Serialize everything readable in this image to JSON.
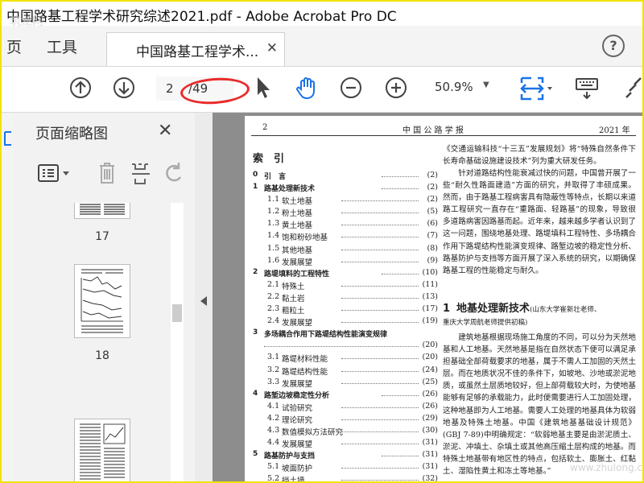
{
  "window": {
    "title": "中国路基工程学术研究综述2021.pdf - Adobe Acrobat Pro DC"
  },
  "tabs": {
    "home_partial": "页",
    "tools": "工具",
    "document": "中国路基工程学术..."
  },
  "toolbar": {
    "current_page": "2",
    "page_separator": "/",
    "total_pages": "49",
    "zoom": "50.9%"
  },
  "panel": {
    "title": "页面缩略图",
    "thumbnails": [
      {
        "number": "17"
      },
      {
        "number": "18"
      }
    ]
  },
  "page": {
    "header_left": "2",
    "journal": "中 国 公 路 学 报",
    "header_right": "2021 年",
    "toc_title": "索　引",
    "toc": [
      {
        "num": "0",
        "label": "引　言",
        "page": "(2)",
        "level": "main"
      },
      {
        "num": "1",
        "label": "路基处理新技术",
        "page": "(2)",
        "level": "main"
      },
      {
        "num": "1.1",
        "label": "软土地基",
        "page": "(2)",
        "level": "sub"
      },
      {
        "num": "1.2",
        "label": "粉土地基",
        "page": "(5)",
        "level": "sub"
      },
      {
        "num": "1.3",
        "label": "黄土地基",
        "page": "(6)",
        "level": "sub"
      },
      {
        "num": "1.4",
        "label": "饱和粉砂地基",
        "page": "(7)",
        "level": "sub"
      },
      {
        "num": "1.5",
        "label": "其他地基",
        "page": "(8)",
        "level": "sub"
      },
      {
        "num": "1.6",
        "label": "发展展望",
        "page": "(9)",
        "level": "sub"
      },
      {
        "num": "2",
        "label": "路堤填料的工程特性",
        "page": "(10)",
        "level": "main"
      },
      {
        "num": "2.1",
        "label": "特殊土",
        "page": "(11)",
        "level": "sub"
      },
      {
        "num": "2.2",
        "label": "黏土岩",
        "page": "(13)",
        "level": "sub"
      },
      {
        "num": "2.3",
        "label": "粗粒土",
        "page": "(17)",
        "level": "sub"
      },
      {
        "num": "2.4",
        "label": "发展展望",
        "page": "(19)",
        "level": "sub"
      },
      {
        "num": "3",
        "label": "多场耦合作用下路堤结构性能演变规律",
        "page": "",
        "level": "main"
      },
      {
        "num": "",
        "label": "",
        "page": "(20)",
        "level": "cont"
      },
      {
        "num": "3.1",
        "label": "路堤材料性能",
        "page": "(20)",
        "level": "sub"
      },
      {
        "num": "3.2",
        "label": "路堤结构性能",
        "page": "(24)",
        "level": "sub"
      },
      {
        "num": "3.3",
        "label": "发展展望",
        "page": "(25)",
        "level": "sub"
      },
      {
        "num": "4",
        "label": "路堑边坡稳定性分析",
        "page": "(26)",
        "level": "main"
      },
      {
        "num": "4.1",
        "label": "试验研究",
        "page": "(26)",
        "level": "sub"
      },
      {
        "num": "4.2",
        "label": "理论研究",
        "page": "(29)",
        "level": "sub"
      },
      {
        "num": "4.3",
        "label": "数值模拟方法研究",
        "page": "(30)",
        "level": "sub"
      },
      {
        "num": "4.4",
        "label": "发展展望",
        "page": "(31)",
        "level": "sub"
      },
      {
        "num": "5",
        "label": "路基防护与支挡",
        "page": "(31)",
        "level": "main"
      },
      {
        "num": "5.1",
        "label": "坡面防护",
        "page": "(31)",
        "level": "sub"
      },
      {
        "num": "5.2",
        "label": "挡土墙",
        "page": "(32)",
        "level": "sub"
      }
    ],
    "para1": "《交通运输科技“十三五”发展规划》将“特殊自然条件下长寿命基础设施建设技术”列为重大研发任务。",
    "para2": "针对道路结构性能衰减过快的问题，中国曾开展了一些“耐久性路面建造”方面的研究，并取得了丰硕成果。然而，由于路基工程病害具有隐蔽性等特点，长期以来道路工程研究一直存在“重路面、轻路基”的现象，导致很多道路病害因路基而起。近年来，越来越多学者认识到了这一问题，围绕地基处理、路堤填料工程特性、多场耦合作用下路堤结构性能演变规律、路堑边坡的稳定性分析、路基防护与支挡等方面开展了深入系统的研究，以期确保路基工程的性能稳定与耐久。",
    "section1": {
      "number": "1",
      "title": "地基处理新技术",
      "authors": "(山东大学崔新壮老师、",
      "authors2": "重庆大学周航老师提供初稿)"
    },
    "para3": "建筑地基根据现场施工角度的不同，可以分为天然地基和人工地基。天然地基是指在自然状态下便可以满足承担基础全部荷载要求的地基，属于不需人工加固的天然土层。而在地质状况不佳的条件下，如坡地、沙地或淤泥地质，或虽然土层质地较好，但上部荷载较大时，为使地基能够有足够的承载能力，此时便需要进行人工加固处理，这种地基即为人工地基。需要人工处理的地基具体为软弱地基及特殊土地基。中国《建筑地基基础设计规范》(GBJ 7-89)中明确规定：“软弱地基主要是由淤泥质土、淤泥、冲填土、杂填土或其他高压缩土层构成的地基。而特殊土地基带有地区性的特点，包括软土、膨胀土、红黏土、湿陷性黄土和冻土等地基。”",
    "watermark": "www.zhulong.com",
    "watermark_corner": "筑龙网"
  },
  "colors": {
    "highlight": "#e82b2b",
    "border": "#f2e200"
  }
}
